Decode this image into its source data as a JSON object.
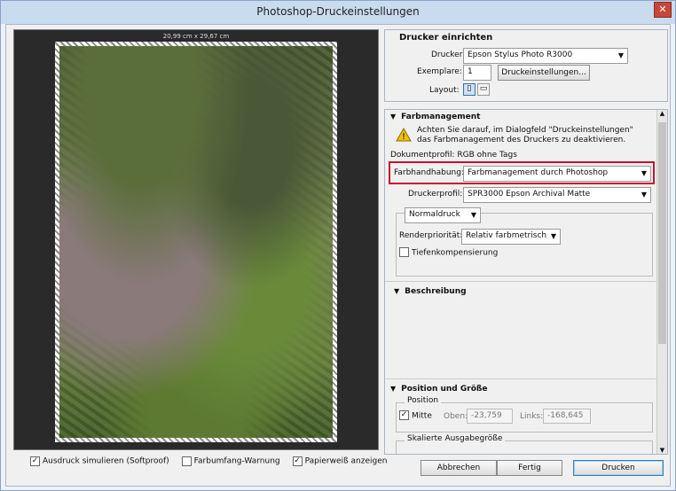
{
  "window": {
    "title": "Photoshop-Druckeinstellungen",
    "close": "✕"
  },
  "preview": {
    "dimensions": "20,99 cm x 29,67 cm"
  },
  "bottom_checks": [
    {
      "label": "Ausdruck simulieren (Softproof)",
      "checked": "✓"
    },
    {
      "label": "Farbumfang-Warnung",
      "checked": ""
    },
    {
      "label": "Papierweiß anzeigen",
      "checked": "✓"
    }
  ],
  "printer_setup": {
    "heading": "Drucker einrichten",
    "printer_label": "Drucker:",
    "printer_value": "Epson Stylus Photo R3000",
    "copies_label": "Exemplare:",
    "copies_value": "1",
    "print_settings_button": "Druckeinstellungen...",
    "layout_label": "Layout:"
  },
  "color_management": {
    "heading": "Farbmanagement",
    "warning_line1": "Achten Sie darauf, im Dialogfeld \"Druckeinstellungen\"",
    "warning_line2": "das Farbmanagement des Druckers zu deaktivieren.",
    "doc_profile": "Dokumentprofil: RGB ohne Tags",
    "color_handling_label": "Farbhandhabung:",
    "color_handling_value": "Farbmanagement durch Photoshop",
    "printer_profile_label": "Druckerprofil:",
    "printer_profile_value": "SPR3000 Epson Archival Matte",
    "print_mode_value": "Normaldruck",
    "intent_label": "Renderpriorität:",
    "intent_value": "Relativ farbmetrisch",
    "bpc_label": "Tiefenkompensierung",
    "highlight_color": "#c8102e"
  },
  "description": {
    "heading": "Beschreibung"
  },
  "position_size": {
    "heading": "Position und Größe",
    "position_group": "Position",
    "center_label": "Mitte",
    "top_label": "Oben:",
    "top_value": "-23,759",
    "left_label": "Links:",
    "left_value": "-168,645",
    "scaled_group": "Skalierte Ausgabegröße"
  },
  "buttons": {
    "cancel": "Abbrechen",
    "done": "Fertig",
    "print": "Drucken"
  }
}
